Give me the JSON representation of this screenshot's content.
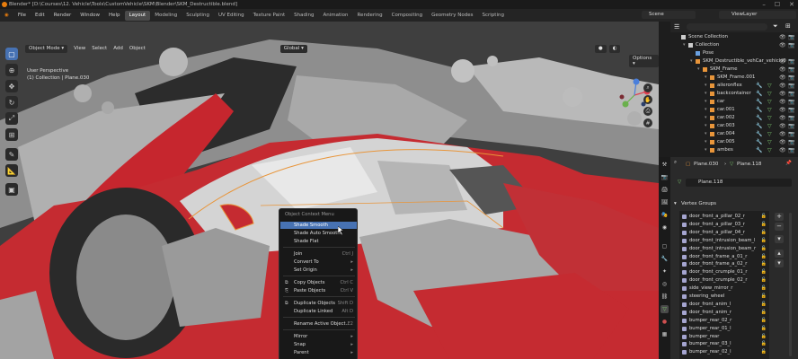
{
  "window": {
    "title": "Blender* [D:\\Courses\\12. Vehicle\\Tools\\CustomVehicle\\SKM\\Blender\\SKM_Destructible.blend]",
    "controls": [
      "–",
      "☐",
      "✕"
    ]
  },
  "menu": [
    "File",
    "Edit",
    "Render",
    "Window",
    "Help"
  ],
  "workspaces": [
    "Layout",
    "Modeling",
    "Sculpting",
    "UV Editing",
    "Texture Paint",
    "Shading",
    "Animation",
    "Rendering",
    "Compositing",
    "Geometry Nodes",
    "Scripting"
  ],
  "active_workspace": "Layout",
  "scene": "Scene",
  "view_layer": "ViewLayer",
  "viewport": {
    "mode": "Object Mode",
    "menus": [
      "View",
      "Select",
      "Add",
      "Object"
    ],
    "transform": "Global",
    "perspective": "User Perspective",
    "collection_info": "(1) Collection | Plane.030",
    "options": "Options"
  },
  "context_menu": {
    "title": "Object Context Menu",
    "items": [
      {
        "label": "Shade Smooth",
        "shortcut": "",
        "highlighted": true
      },
      {
        "label": "Shade Auto Smooth",
        "shortcut": ""
      },
      {
        "label": "Shade Flat",
        "shortcut": ""
      },
      {
        "label": "Join",
        "shortcut": "Ctrl J"
      },
      {
        "label": "Convert To",
        "shortcut": "▸"
      },
      {
        "label": "Set Origin",
        "shortcut": "▸"
      },
      {
        "label": "Copy Objects",
        "shortcut": "Ctrl C"
      },
      {
        "label": "Paste Objects",
        "shortcut": "Ctrl V"
      },
      {
        "label": "Duplicate Objects",
        "shortcut": "Shift D"
      },
      {
        "label": "Duplicate Linked",
        "shortcut": "Alt D"
      },
      {
        "label": "Rename Active Object...",
        "shortcut": "F2"
      },
      {
        "label": "Mirror",
        "shortcut": "▸"
      },
      {
        "label": "Snap",
        "shortcut": "▸"
      },
      {
        "label": "Parent",
        "shortcut": "▸"
      }
    ]
  },
  "outliner": {
    "rows": [
      {
        "name": "Scene Collection",
        "indent": 0,
        "type": "scene"
      },
      {
        "name": "Collection",
        "indent": 1,
        "type": "collection"
      },
      {
        "name": "Pose",
        "indent": 2,
        "type": "pose"
      },
      {
        "name": "SKM_Destructible_vehCar_vehicle0",
        "indent": 2,
        "type": "armature"
      },
      {
        "name": "SKM_Frame",
        "indent": 3,
        "type": "mesh"
      },
      {
        "name": "SKM_Frame.001",
        "indent": 4,
        "type": "mesh"
      },
      {
        "name": "aileronflex",
        "indent": 4,
        "type": "obj"
      },
      {
        "name": "backcontainer",
        "indent": 4,
        "type": "obj"
      },
      {
        "name": "car",
        "indent": 4,
        "type": "obj"
      },
      {
        "name": "car.001",
        "indent": 4,
        "type": "obj"
      },
      {
        "name": "car.002",
        "indent": 4,
        "type": "obj"
      },
      {
        "name": "car.003",
        "indent": 4,
        "type": "obj"
      },
      {
        "name": "car.004",
        "indent": 4,
        "type": "obj"
      },
      {
        "name": "car.005",
        "indent": 4,
        "type": "obj"
      },
      {
        "name": "ambes",
        "indent": 4,
        "type": "obj"
      }
    ]
  },
  "properties": {
    "breadcrumb_obj": "Plane.030",
    "breadcrumb_mesh": "Plane.118",
    "mesh_name": "Plane.118",
    "section": "Vertex Groups",
    "vertex_groups": [
      "door_front_a_pillar_02_r",
      "door_front_a_pillar_03_r",
      "door_front_a_pillar_04_r",
      "door_front_intrusion_beam_l",
      "door_front_intrusion_beam_r",
      "door_front_frame_a_01_r",
      "door_front_frame_a_02_r",
      "door_front_crumple_01_r",
      "door_front_crumple_02_r",
      "side_view_mirror_r",
      "steering_wheel",
      "door_front_anim_l",
      "door_front_anim_r",
      "bumper_rear_02_r",
      "bumper_rear_01_l",
      "bumper_rear",
      "bumper_rear_03_l",
      "bumper_rear_02_l"
    ]
  }
}
